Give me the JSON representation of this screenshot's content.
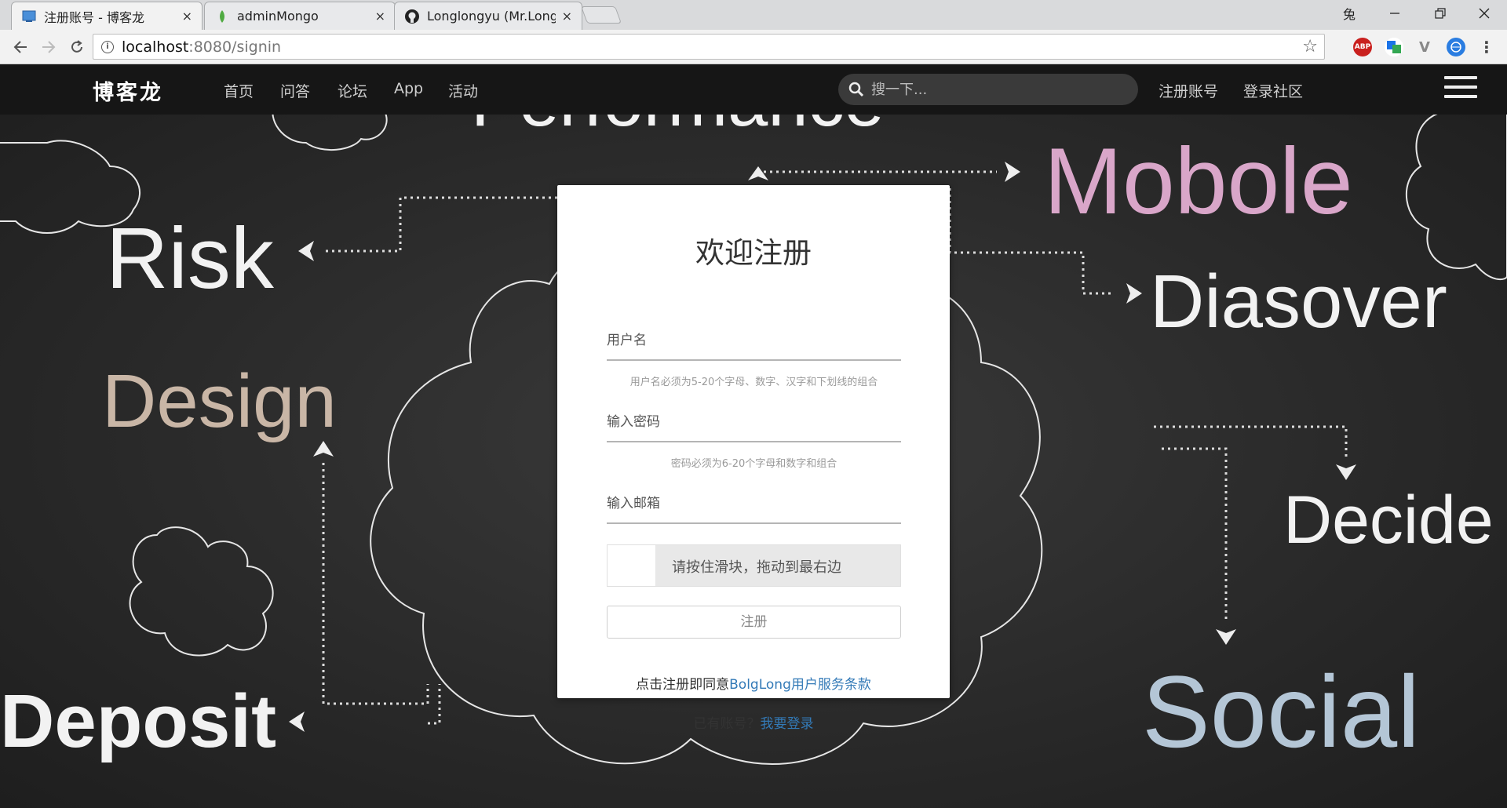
{
  "browser": {
    "tabs": [
      {
        "label": "注册账号 - 博客龙",
        "active": true,
        "icon": "page-icon"
      },
      {
        "label": "adminMongo",
        "active": false,
        "icon": "mongo-leaf-icon"
      },
      {
        "label": "Longlongyu (Mr.Long)",
        "active": false,
        "icon": "github-icon"
      }
    ],
    "tab_close_glyph": "×",
    "profile_glyph": "兔",
    "url_host": "localhost",
    "url_rest": ":8080/signin",
    "extensions": [
      "ABP",
      "translate",
      "V",
      "globe"
    ]
  },
  "site": {
    "brand": "博客龙",
    "nav": [
      "首页",
      "问答",
      "论坛",
      "App",
      "活动"
    ],
    "search_placeholder": "搜一下...",
    "register_link": "注册账号",
    "login_link": "登录社区"
  },
  "background_words": [
    "Performance",
    "Mobole",
    "Risk",
    "Diasover",
    "Design",
    "Decide",
    "Deposit",
    "Social"
  ],
  "form": {
    "title": "欢迎注册",
    "username_placeholder": "用户名",
    "username_hint": "用户名必须为5-20个字母、数字、汉字和下划线的组合",
    "password_placeholder": "输入密码",
    "password_hint": "密码必须为6-20个字母和数字和组合",
    "email_placeholder": "输入邮箱",
    "slider_text": "请按住滑块，拖动到最右边",
    "submit_label": "注册",
    "terms_prefix": "点击注册即同意",
    "terms_link": "BolgLong用户服务条款",
    "login_prefix": "已有账号？",
    "login_link": "我要登录"
  },
  "colors": {
    "accent_link": "#337ab7",
    "nav_bg": "#161616",
    "mobole_pink": "#d9a6c9",
    "design_tan": "#c9b6a6",
    "social_blue": "#b4c6d6"
  }
}
